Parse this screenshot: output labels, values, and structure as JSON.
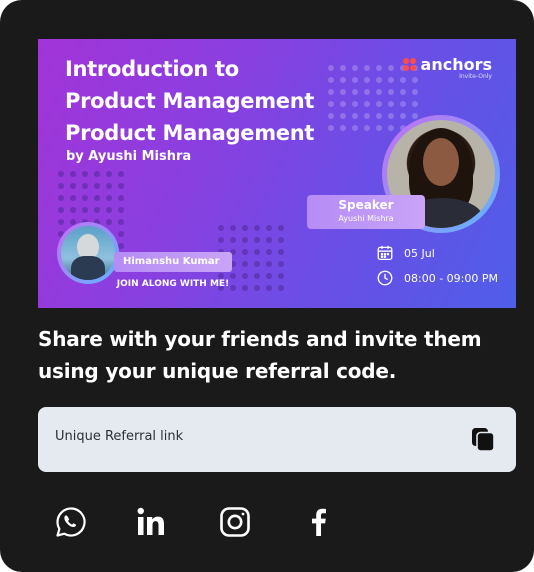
{
  "banner": {
    "title_lines": [
      "Introduction to",
      "Product Management",
      "Product Management"
    ],
    "byline": "by Ayushi Mishra",
    "brand": {
      "name": "anchors",
      "tagline": "Invite-Only",
      "color": "#ff4a4a"
    },
    "speaker": {
      "label": "Speaker",
      "name": "Ayushi Mishra"
    },
    "date": "05 Jul",
    "time": "08:00 - 09:00 PM",
    "host": {
      "name": "Himanshu Kumar",
      "cta": "JOIN ALONG WITH ME!"
    },
    "gradient": [
      "#a234d8",
      "#4f5ee8"
    ]
  },
  "share": {
    "headline_lines": [
      "Share with your friends and invite them",
      "using your unique referral code."
    ]
  },
  "referral": {
    "label": "Unique Referral link",
    "copy_icon": "copy-icon"
  },
  "socials": [
    {
      "name": "whatsapp",
      "icon": "whatsapp-icon"
    },
    {
      "name": "linkedin",
      "icon": "linkedin-icon"
    },
    {
      "name": "instagram",
      "icon": "instagram-icon"
    },
    {
      "name": "facebook",
      "icon": "facebook-icon"
    }
  ],
  "colors": {
    "card_bg": "#1a1a1a",
    "field_bg": "#e5e9f0",
    "text": "#ffffff"
  }
}
